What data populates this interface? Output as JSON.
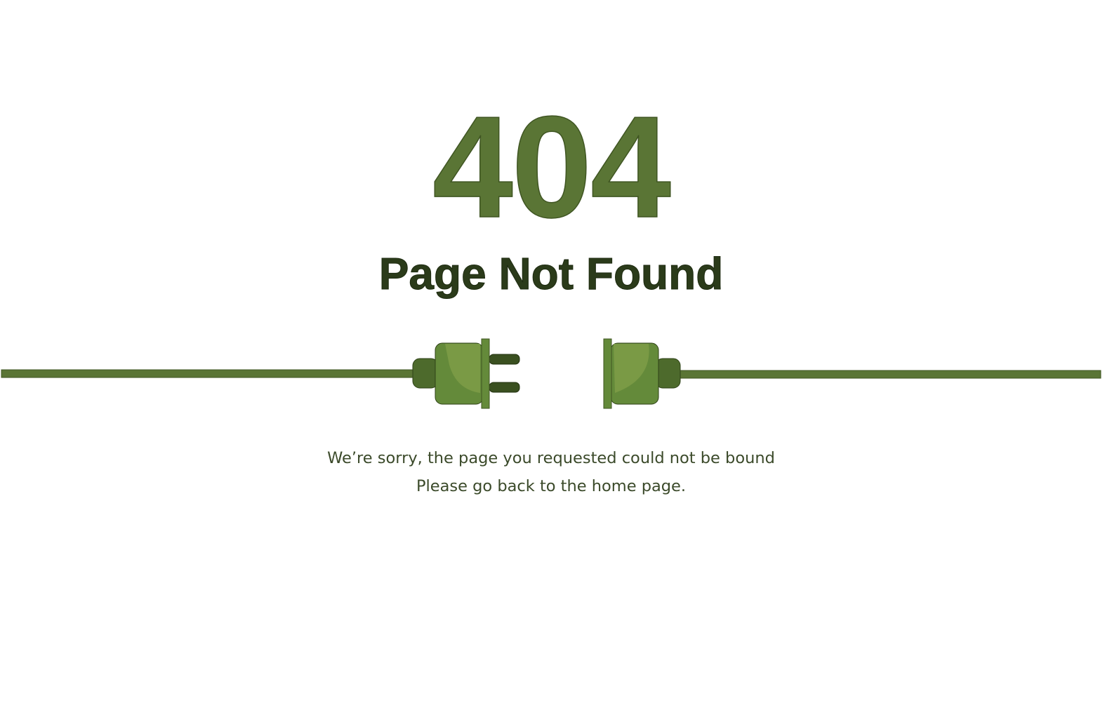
{
  "error": {
    "code": "404",
    "title": "Page Not Found",
    "message_line1": "We’re sorry, the page you requested could not be bound",
    "message_line2": "Please go back to the home page."
  },
  "illustration": {
    "name": "unplugged-cable",
    "primary_color": "#5a7535",
    "light_color": "#7a9a45",
    "dark_color": "#3f5522"
  }
}
